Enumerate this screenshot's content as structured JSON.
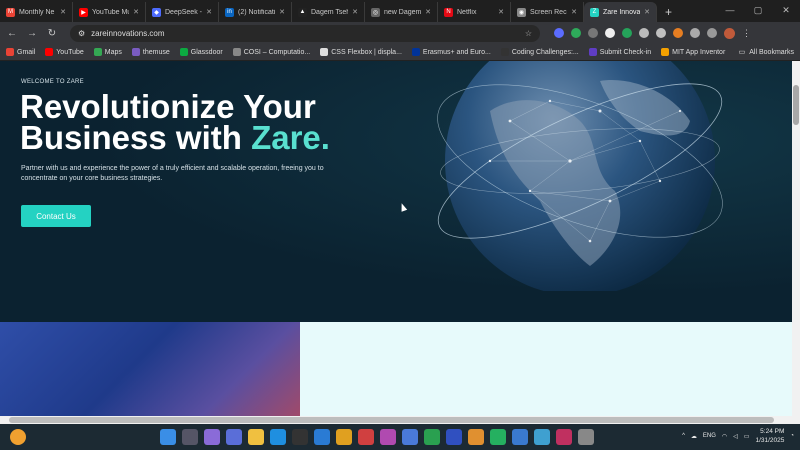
{
  "tabs": [
    {
      "label": "Monthly Ne",
      "color": "#ea4335",
      "glyph": "M"
    },
    {
      "label": "YouTube Mu",
      "color": "#ff0000",
      "glyph": "▶"
    },
    {
      "label": "DeepSeek - I",
      "color": "#4d6bfe",
      "glyph": "◆"
    },
    {
      "label": "(2) Notificati",
      "color": "#0a66c2",
      "glyph": "in"
    },
    {
      "label": "Dagem Tsehı",
      "color": "#222222",
      "glyph": "▲"
    },
    {
      "label": "new Dagem",
      "color": "#666666",
      "glyph": "◎"
    },
    {
      "label": "Netflix",
      "color": "#e50914",
      "glyph": "N"
    },
    {
      "label": "Screen Reco",
      "color": "#888888",
      "glyph": "◉"
    },
    {
      "label": "Zare Innova",
      "color": "#24d2c2",
      "glyph": "Z"
    }
  ],
  "address": {
    "url": "zareinnovations.com"
  },
  "bookmarks": [
    {
      "label": "Gmail",
      "color": "#ea4335"
    },
    {
      "label": "YouTube",
      "color": "#ff0000"
    },
    {
      "label": "Maps",
      "color": "#34a853"
    },
    {
      "label": "themuse",
      "color": "#7a5cc2"
    },
    {
      "label": "Glassdoor",
      "color": "#0caa41"
    },
    {
      "label": "COSI – Computatio...",
      "color": "#888888"
    },
    {
      "label": "CSS Flexbox | displa...",
      "color": "#dddddd"
    },
    {
      "label": "Erasmus+ and Euro...",
      "color": "#003399"
    },
    {
      "label": "Coding Challenges:...",
      "color": "#333333"
    },
    {
      "label": "Submit Check-in",
      "color": "#5f3dc4"
    },
    {
      "label": "MIT App Inventor",
      "color": "#f4a100"
    }
  ],
  "all_bookmarks": "All Bookmarks",
  "hero": {
    "eyebrow": "WELCOME TO ZARE",
    "headline_line1": "Revolutionize Your",
    "headline_line2_prefix": "Business with ",
    "headline_accent": "Zare.",
    "description": "Partner with us and experience the power of a truly efficient and scalable operation, freeing you to concentrate on your core business strategies.",
    "cta": "Contact Us"
  },
  "taskbar": {
    "lang": "ENG",
    "time": "5:24 PM",
    "date": "1/31/2025"
  },
  "colors": {
    "accent": "#59e0d0",
    "button": "#24d2c2",
    "hero_bg": "#0b2230"
  }
}
